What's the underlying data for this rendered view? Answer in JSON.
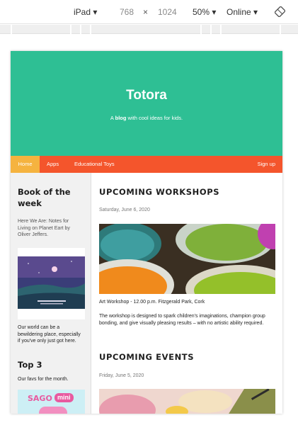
{
  "devtools": {
    "device": "iPad ▾",
    "width": "768",
    "times": "×",
    "height": "1024",
    "zoom": "50% ▾",
    "network": "Online ▾",
    "rotate_icon": "rotate-icon"
  },
  "site": {
    "title": "Totora",
    "tagline_prefix": "A ",
    "tagline_bold": "blog",
    "tagline_suffix": " with cool ideas for kids."
  },
  "nav": {
    "items": [
      "Home",
      "Apps",
      "Educational Toys"
    ],
    "signup": "Sign up"
  },
  "sidebar": {
    "book_heading": "Book of the week",
    "book_desc": "Here We Are: Notes for Living on Planet Eart by Oliver Jeffers.",
    "book_note": "Our world can be a bewildering place, especially if you've only just got here.",
    "top_heading": "Top 3",
    "top_desc": "Our favs for the month.",
    "app_logo_text": "SAGO",
    "app_logo_badge": "mini"
  },
  "main": {
    "workshops_title": "UPCOMING WORKSHOPS",
    "workshops_date": "Saturday, June 6, 2020",
    "workshops_caption": "Art Workshop - 12.00 p.m. Fitzgerald Park, Cork",
    "workshops_body": "The workshop is designed to spark children's imaginations, champion group bonding, and give visually pleasing results – with no artistic ability required.",
    "events_title": "UPCOMING EVENTS",
    "events_date": "Friday, June 5, 2020"
  },
  "colors": {
    "hero": "#2ebf94",
    "nav": "#f4552c",
    "nav_active": "#f5b33f",
    "sidebar_bg": "#f1f1f1"
  }
}
